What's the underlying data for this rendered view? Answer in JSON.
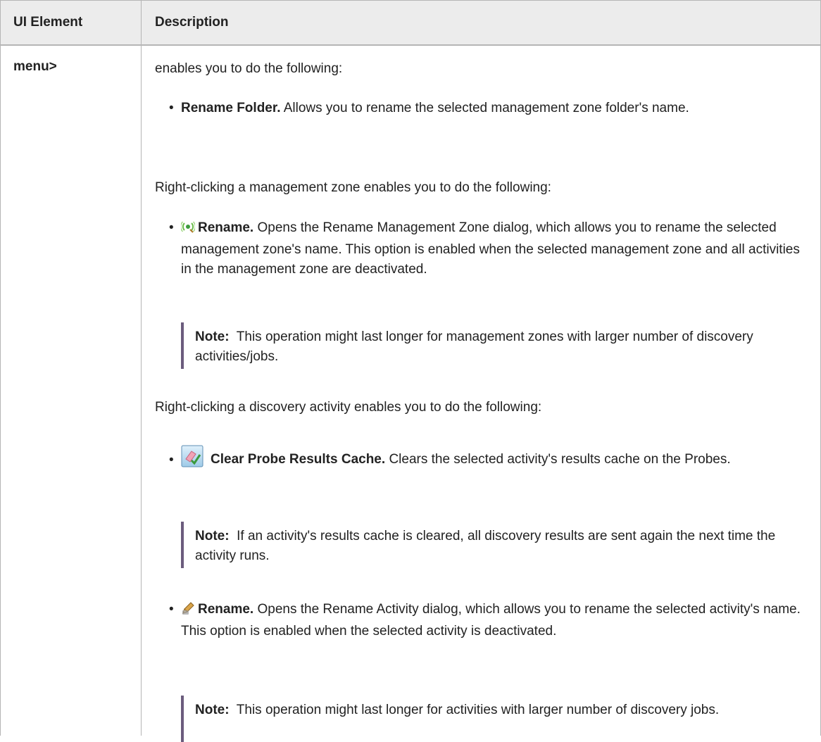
{
  "table": {
    "headers": {
      "col1": "UI Element",
      "col2": "Description"
    },
    "row": {
      "label": "menu>",
      "intro": "enables you to do the following:",
      "folder_item": {
        "title": "Rename Folder.",
        "text": "Allows you to rename the selected management zone folder's name."
      },
      "zone_intro": "Right-clicking a management zone enables you to do the following:",
      "zone_item": {
        "icon": "management-zone-rename-icon",
        "title": "Rename.",
        "text": "Opens the Rename Management Zone dialog, which allows you to rename the selected management zone's name. This option is enabled when the selected management zone and all activities in the management zone are deactivated."
      },
      "zone_note": {
        "label": "Note:",
        "text": "This operation might last longer for management zones with larger number of discovery activities/jobs."
      },
      "activity_intro": "Right-clicking a discovery activity enables you to do the following:",
      "clear_item": {
        "icon": "clear-cache-icon",
        "title": "Clear Probe Results Cache.",
        "text": "Clears the selected activity's results cache on the Probes."
      },
      "clear_note": {
        "label": "Note:",
        "text": "If an activity's results cache is cleared, all discovery results are sent again the next time the activity runs."
      },
      "activity_item": {
        "icon": "rename-pencil-icon",
        "title": "Rename.",
        "text": "Opens the Rename Activity dialog, which allows you to rename the selected activity's name. This option is enabled when the selected activity is deactivated."
      },
      "activity_note": {
        "label": "Note:",
        "text": "This operation might last longer for activities with larger number of discovery jobs."
      }
    }
  },
  "colors": {
    "header_bg": "#ececec",
    "border": "#b5b5b5",
    "note_bar": "#6b5c7d",
    "text": "#222222"
  }
}
